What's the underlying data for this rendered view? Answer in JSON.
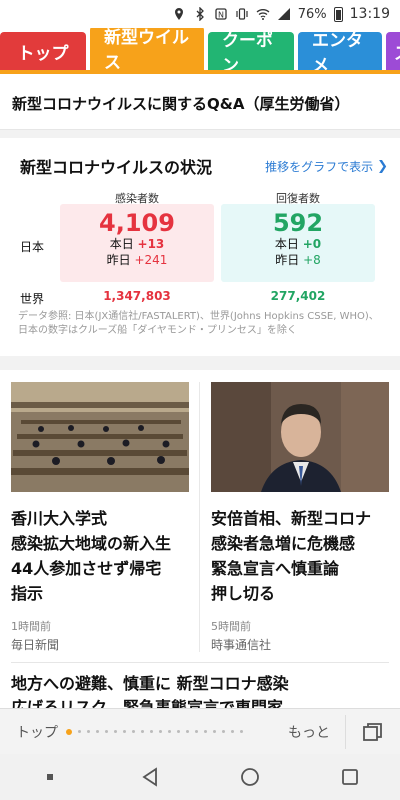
{
  "status_bar": {
    "battery": "76%",
    "time": "13:19"
  },
  "tabs": [
    {
      "label": "トップ"
    },
    {
      "label": "新型ウイルス"
    },
    {
      "label": "クーポン"
    },
    {
      "label": "エンタメ"
    },
    {
      "label": "ス"
    }
  ],
  "qa_link": "新型コロナウイルスに関するQ&A（厚生労働省）",
  "status": {
    "title": "新型コロナウイルスの状況",
    "graph_link": "推移をグラフで表示",
    "infected_header": "感染者数",
    "recovered_header": "回復者数",
    "japan_label": "日本",
    "world_label": "世界",
    "japan_infected": "4,109",
    "japan_infected_today_label": "本日",
    "japan_infected_today": "+13",
    "japan_infected_yesterday_label": "昨日",
    "japan_infected_yesterday": "+241",
    "japan_recovered": "592",
    "japan_recovered_today_label": "本日",
    "japan_recovered_today": "+0",
    "japan_recovered_yesterday_label": "昨日",
    "japan_recovered_yesterday": "+8",
    "world_infected": "1,347,803",
    "world_recovered": "277,402",
    "source": "データ参照: 日本(JX通信社/FASTALERT)、世界(Johns Hopkins CSSE, WHO)、日本の数字はクルーズ船「ダイヤモンド・プリンセス」を除く"
  },
  "news": [
    {
      "headline": "香川大入学式\n感染拡大地域の新入生\n44人参加させず帰宅\n指示",
      "time": "1時間前",
      "source": "毎日新聞"
    },
    {
      "headline": "安倍首相、新型コロナ\n感染者急増に危機感\n緊急宣言へ慎重論\n押し切る",
      "time": "5時間前",
      "source": "時事通信社"
    }
  ],
  "news_wide": "地方への避難、慎重に 新型コロナ感染\n広げるリスク　緊急事態宣言で専門家",
  "pager": {
    "top_label": "トップ",
    "more_label": "もっと"
  },
  "colors": {
    "accent": "#f7a21a",
    "red": "#e5333f",
    "green": "#22a563",
    "link": "#2b7bd3"
  }
}
